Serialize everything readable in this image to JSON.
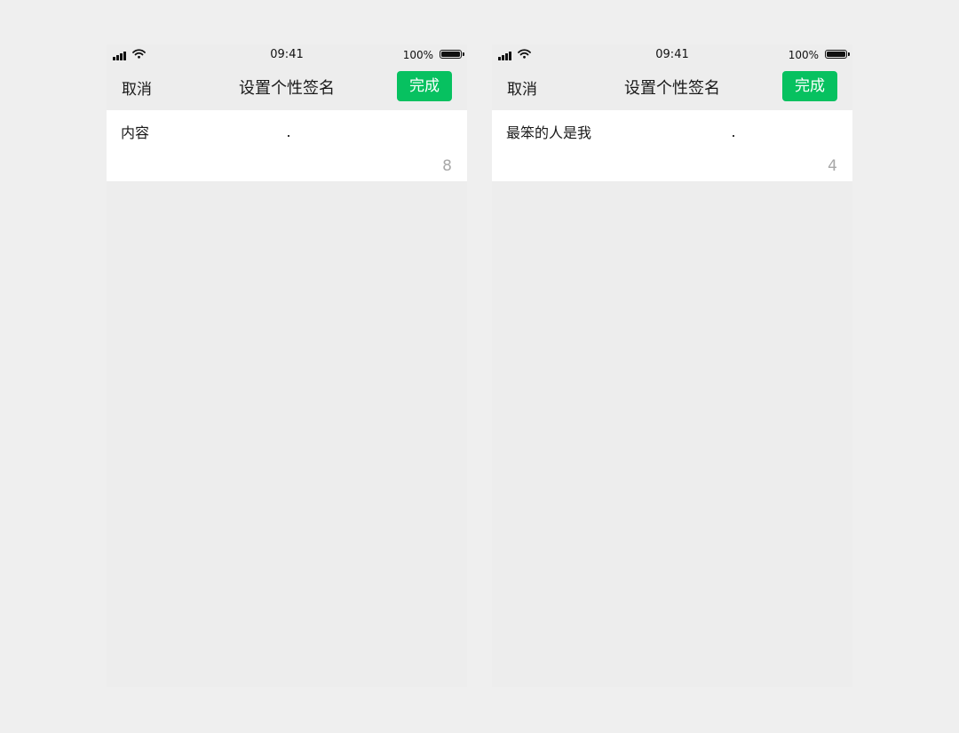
{
  "screens": [
    {
      "status_bar": {
        "time": "09:41",
        "battery_percent": "100%"
      },
      "nav": {
        "cancel_label": "取消",
        "title": "设置个性签名",
        "done_label": "完成"
      },
      "input": {
        "text": "内容",
        "remaining_count": "8"
      }
    },
    {
      "status_bar": {
        "time": "09:41",
        "battery_percent": "100%"
      },
      "nav": {
        "cancel_label": "取消",
        "title": "设置个性签名",
        "done_label": "完成"
      },
      "input": {
        "text": "最笨的人是我",
        "remaining_count": "4"
      }
    }
  ],
  "icons": {
    "signal": "signal-bars-icon",
    "wifi": "wifi-icon",
    "battery": "battery-icon"
  },
  "colors": {
    "accent": "#07c160",
    "screen_background": "#ededed",
    "page_background": "#efefef",
    "card_background": "#ffffff",
    "counter_text": "#a8a8a8"
  }
}
